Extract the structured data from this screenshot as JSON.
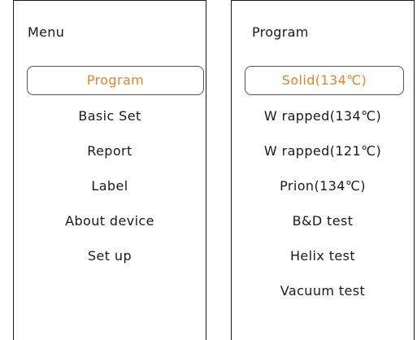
{
  "accent_color": "#e8822a",
  "menu": {
    "title": "Menu",
    "selected_index": 0,
    "items": [
      {
        "label": "Program"
      },
      {
        "label": "Basic Set"
      },
      {
        "label": "Report"
      },
      {
        "label": "Label"
      },
      {
        "label": "About device"
      },
      {
        "label": "Set up"
      }
    ]
  },
  "program": {
    "title": "Program",
    "selected_index": 0,
    "items": [
      {
        "label": "Solid(134℃)"
      },
      {
        "label": "W rapped(134℃)"
      },
      {
        "label": "W rapped(121℃)"
      },
      {
        "label": "Prion(134℃)"
      },
      {
        "label": "B&D test"
      },
      {
        "label": "Helix test"
      },
      {
        "label": "Vacuum test"
      }
    ]
  }
}
